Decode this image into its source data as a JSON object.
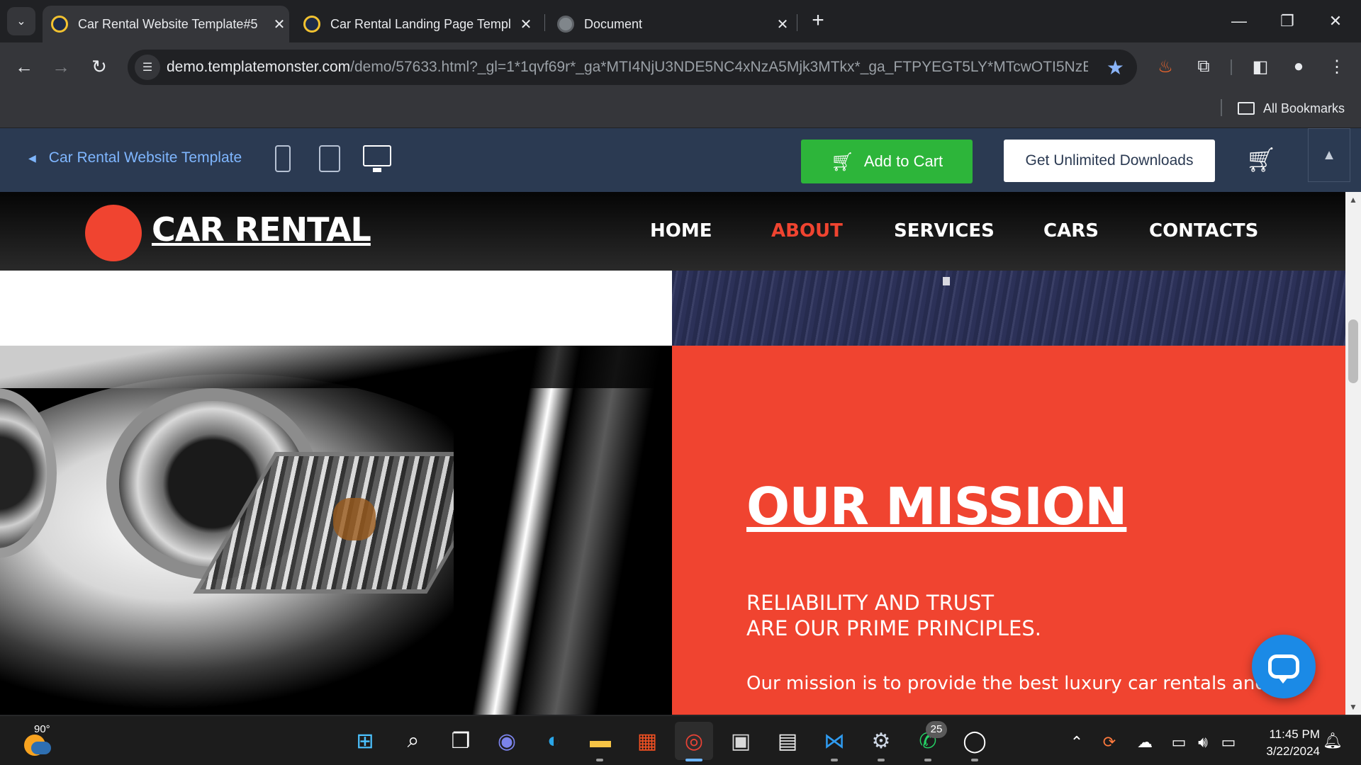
{
  "browser": {
    "tabs": [
      {
        "title": "Car Rental Website Template#5",
        "active": true
      },
      {
        "title": "Car Rental Landing Page Templ",
        "active": false
      },
      {
        "title": "Document",
        "active": false
      }
    ],
    "new_tab_label": "+",
    "address": {
      "host": "demo.templatemonster.com",
      "path": "/demo/57633.html?_gl=1*1qvf69r*_ga*MTI4NjU3NDE5NC4xNzA5Mjk3MTkx*_ga_FTPYEGT5LY*MTcwOTI5NzE5..."
    },
    "bookmarks_label": "All Bookmarks"
  },
  "preview_bar": {
    "back_label": "Car Rental Website Template",
    "add_to_cart_label": "Add to Cart",
    "unlimited_label": "Get Unlimited Downloads"
  },
  "site": {
    "logo_text": "CAR RENTAL",
    "nav": [
      "HOME",
      "ABOUT",
      "SERVICES",
      "CARS",
      "CONTACTS"
    ],
    "active_nav": "ABOUT",
    "accent_color": "#f04430",
    "mission": {
      "heading": "OUR MISSION",
      "sub_line1": "RELIABILITY AND TRUST",
      "sub_line2": "ARE OUR PRIME PRINCIPLES.",
      "body": "Our mission is to provide the best luxury car rentals and"
    }
  },
  "taskbar": {
    "weather_temp": "90°",
    "whatsapp_badge": "25",
    "time": "11:45 PM",
    "date": "3/22/2024"
  }
}
